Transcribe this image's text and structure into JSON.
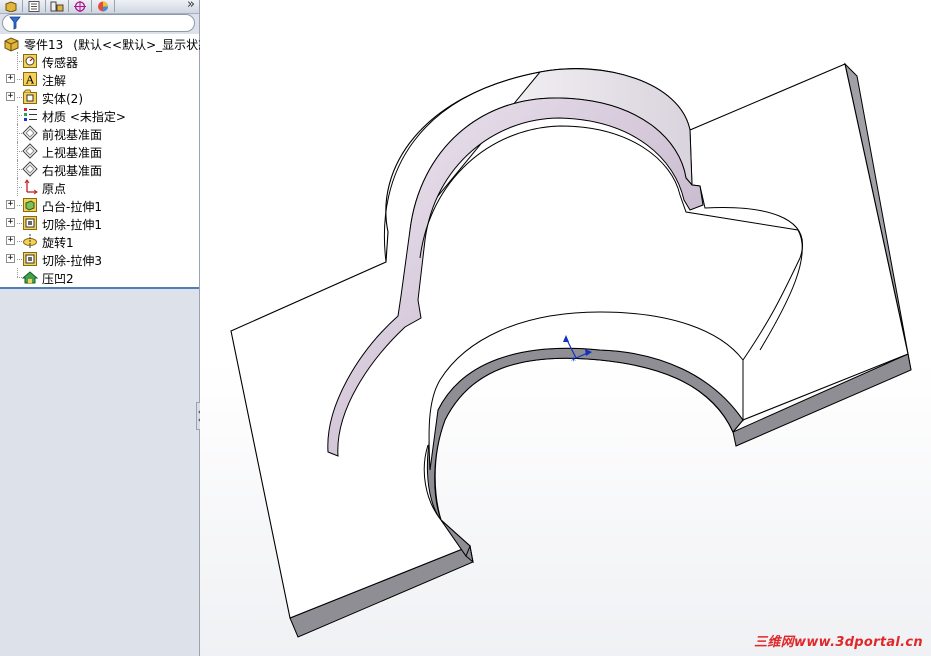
{
  "panel": {
    "more_symbol": "»",
    "tabs": [
      "feature-manager-tab",
      "property-manager-tab",
      "configuration-manager-tab",
      "dimxpert-manager-tab",
      "display-manager-tab"
    ],
    "root": {
      "label": "零件13",
      "config": "(默认<<默认>_显示状态"
    },
    "items": [
      {
        "label": "传感器",
        "icon": "sensor-icon",
        "expandable": false
      },
      {
        "label": "注解",
        "icon": "annotations-icon",
        "expandable": true
      },
      {
        "label": "实体(2)",
        "icon": "solid-bodies-icon",
        "expandable": true
      },
      {
        "label": "材质 <未指定>",
        "icon": "material-icon",
        "expandable": false
      },
      {
        "label": "前视基准面",
        "icon": "plane-icon",
        "expandable": false
      },
      {
        "label": "上视基准面",
        "icon": "plane-icon",
        "expandable": false
      },
      {
        "label": "右视基准面",
        "icon": "plane-icon",
        "expandable": false
      },
      {
        "label": "原点",
        "icon": "origin-icon",
        "expandable": false
      },
      {
        "label": "凸台-拉伸1",
        "icon": "boss-extrude-icon",
        "expandable": true
      },
      {
        "label": "切除-拉伸1",
        "icon": "cut-extrude-icon",
        "expandable": true
      },
      {
        "label": "旋转1",
        "icon": "revolve-icon",
        "expandable": true
      },
      {
        "label": "切除-拉伸3",
        "icon": "cut-extrude-icon",
        "expandable": true
      },
      {
        "label": "压凹2",
        "icon": "indent-icon",
        "expandable": false
      }
    ]
  },
  "viewport": {
    "watermark": "三维网www.3dportal.cn",
    "colors": {
      "edge": "#000000",
      "face_dark": "#8e8e94",
      "face_light": "#ffffff",
      "accent_blue": "#1030c0"
    }
  }
}
